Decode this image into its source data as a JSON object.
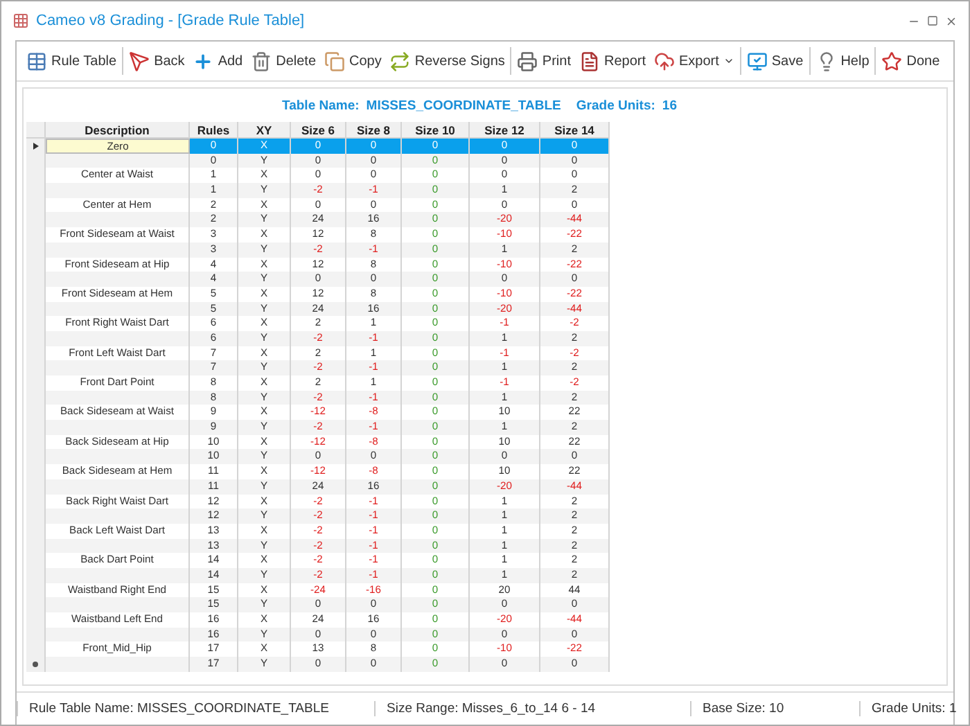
{
  "window": {
    "title": "Cameo v8 Grading - [Grade Rule Table]"
  },
  "toolbar": [
    {
      "kind": "table",
      "label": "Rule Table"
    },
    {
      "kind": "back",
      "label": "Back"
    },
    {
      "kind": "add",
      "label": "Add"
    },
    {
      "kind": "delete",
      "label": "Delete"
    },
    {
      "kind": "copy",
      "label": "Copy"
    },
    {
      "kind": "reverse",
      "label": "Reverse Signs"
    },
    {
      "kind": "print",
      "label": "Print"
    },
    {
      "kind": "report",
      "label": "Report"
    },
    {
      "kind": "export",
      "label": "Export"
    },
    {
      "kind": "save",
      "label": "Save"
    },
    {
      "kind": "help",
      "label": "Help"
    },
    {
      "kind": "done",
      "label": "Done"
    }
  ],
  "table_info": {
    "name_label": "Table Name:",
    "name": "MISSES_COORDINATE_TABLE",
    "units_label": "Grade Units:",
    "units": "16"
  },
  "table": {
    "columns": [
      {
        "label": "Description"
      },
      {
        "label": "Rules"
      },
      {
        "label": "XY"
      },
      {
        "label": "Size 6",
        "base": false
      },
      {
        "label": "Size 8",
        "base": false
      },
      {
        "label": "Size 10",
        "base": true
      },
      {
        "label": "Size 12",
        "base": false
      },
      {
        "label": "Size 14",
        "base": false
      }
    ],
    "rows": [
      {
        "description": "Zero",
        "rule": "0",
        "xy": "X",
        "values": [
          "0",
          "0",
          "0",
          "0",
          "0"
        ],
        "selected": true
      },
      {
        "rule": "0",
        "xy": "Y",
        "values": [
          "0",
          "0",
          "0",
          "0",
          "0"
        ],
        "selected": false
      },
      {
        "description": "Center at Waist",
        "rule": "1",
        "xy": "X",
        "values": [
          "0",
          "0",
          "0",
          "0",
          "0"
        ],
        "selected": false
      },
      {
        "rule": "1",
        "xy": "Y",
        "values": [
          "-2",
          "-1",
          "0",
          "1",
          "2"
        ],
        "selected": false
      },
      {
        "description": "Center at Hem",
        "rule": "2",
        "xy": "X",
        "values": [
          "0",
          "0",
          "0",
          "0",
          "0"
        ],
        "selected": false
      },
      {
        "rule": "2",
        "xy": "Y",
        "values": [
          "24",
          "16",
          "0",
          "-20",
          "-44"
        ],
        "selected": false
      },
      {
        "description": "Front Sideseam at Waist",
        "rule": "3",
        "xy": "X",
        "values": [
          "12",
          "8",
          "0",
          "-10",
          "-22"
        ],
        "selected": false
      },
      {
        "rule": "3",
        "xy": "Y",
        "values": [
          "-2",
          "-1",
          "0",
          "1",
          "2"
        ],
        "selected": false
      },
      {
        "description": "Front Sideseam at Hip",
        "rule": "4",
        "xy": "X",
        "values": [
          "12",
          "8",
          "0",
          "-10",
          "-22"
        ],
        "selected": false
      },
      {
        "rule": "4",
        "xy": "Y",
        "values": [
          "0",
          "0",
          "0",
          "0",
          "0"
        ],
        "selected": false
      },
      {
        "description": "Front Sideseam at Hem",
        "rule": "5",
        "xy": "X",
        "values": [
          "12",
          "8",
          "0",
          "-10",
          "-22"
        ],
        "selected": false
      },
      {
        "rule": "5",
        "xy": "Y",
        "values": [
          "24",
          "16",
          "0",
          "-20",
          "-44"
        ],
        "selected": false
      },
      {
        "description": "Front Right Waist Dart",
        "rule": "6",
        "xy": "X",
        "values": [
          "2",
          "1",
          "0",
          "-1",
          "-2"
        ],
        "selected": false
      },
      {
        "rule": "6",
        "xy": "Y",
        "values": [
          "-2",
          "-1",
          "0",
          "1",
          "2"
        ],
        "selected": false
      },
      {
        "description": "Front Left Waist Dart",
        "rule": "7",
        "xy": "X",
        "values": [
          "2",
          "1",
          "0",
          "-1",
          "-2"
        ],
        "selected": false
      },
      {
        "rule": "7",
        "xy": "Y",
        "values": [
          "-2",
          "-1",
          "0",
          "1",
          "2"
        ],
        "selected": false
      },
      {
        "description": "Front Dart Point",
        "rule": "8",
        "xy": "X",
        "values": [
          "2",
          "1",
          "0",
          "-1",
          "-2"
        ],
        "selected": false
      },
      {
        "rule": "8",
        "xy": "Y",
        "values": [
          "-2",
          "-1",
          "0",
          "1",
          "2"
        ],
        "selected": false
      },
      {
        "description": "Back Sideseam at Waist",
        "rule": "9",
        "xy": "X",
        "values": [
          "-12",
          "-8",
          "0",
          "10",
          "22"
        ],
        "selected": false
      },
      {
        "rule": "9",
        "xy": "Y",
        "values": [
          "-2",
          "-1",
          "0",
          "1",
          "2"
        ],
        "selected": false
      },
      {
        "description": "Back Sideseam at Hip",
        "rule": "10",
        "xy": "X",
        "values": [
          "-12",
          "-8",
          "0",
          "10",
          "22"
        ],
        "selected": false
      },
      {
        "rule": "10",
        "xy": "Y",
        "values": [
          "0",
          "0",
          "0",
          "0",
          "0"
        ],
        "selected": false
      },
      {
        "description": "Back Sideseam at Hem",
        "rule": "11",
        "xy": "X",
        "values": [
          "-12",
          "-8",
          "0",
          "10",
          "22"
        ],
        "selected": false
      },
      {
        "rule": "11",
        "xy": "Y",
        "values": [
          "24",
          "16",
          "0",
          "-20",
          "-44"
        ],
        "selected": false
      },
      {
        "description": "Back Right Waist Dart",
        "rule": "12",
        "xy": "X",
        "values": [
          "-2",
          "-1",
          "0",
          "1",
          "2"
        ],
        "selected": false
      },
      {
        "rule": "12",
        "xy": "Y",
        "values": [
          "-2",
          "-1",
          "0",
          "1",
          "2"
        ],
        "selected": false
      },
      {
        "description": "Back Left Waist Dart",
        "rule": "13",
        "xy": "X",
        "values": [
          "-2",
          "-1",
          "0",
          "1",
          "2"
        ],
        "selected": false
      },
      {
        "rule": "13",
        "xy": "Y",
        "values": [
          "-2",
          "-1",
          "0",
          "1",
          "2"
        ],
        "selected": false
      },
      {
        "description": "Back Dart Point",
        "rule": "14",
        "xy": "X",
        "values": [
          "-2",
          "-1",
          "0",
          "1",
          "2"
        ],
        "selected": false
      },
      {
        "rule": "14",
        "xy": "Y",
        "values": [
          "-2",
          "-1",
          "0",
          "1",
          "2"
        ],
        "selected": false
      },
      {
        "description": "Waistband Right End",
        "rule": "15",
        "xy": "X",
        "values": [
          "-24",
          "-16",
          "0",
          "20",
          "44"
        ],
        "selected": false
      },
      {
        "rule": "15",
        "xy": "Y",
        "values": [
          "0",
          "0",
          "0",
          "0",
          "0"
        ],
        "selected": false
      },
      {
        "description": "Waistband Left End",
        "rule": "16",
        "xy": "X",
        "values": [
          "24",
          "16",
          "0",
          "-20",
          "-44"
        ],
        "selected": false
      },
      {
        "rule": "16",
        "xy": "Y",
        "values": [
          "0",
          "0",
          "0",
          "0",
          "0"
        ],
        "selected": false
      },
      {
        "description": "Front_Mid_Hip",
        "rule": "17",
        "xy": "X",
        "values": [
          "13",
          "8",
          "0",
          "-10",
          "-22"
        ],
        "selected": false
      },
      {
        "rule": "17",
        "xy": "Y",
        "values": [
          "0",
          "0",
          "0",
          "0",
          "0"
        ],
        "selected": false
      }
    ]
  },
  "status_bar": [
    "Rule Table Name: MISSES_COORDINATE_TABLE",
    "Size Range: Misses_6_to_14 6 - 14",
    "Base Size: 10",
    "Grade Units: 1"
  ]
}
